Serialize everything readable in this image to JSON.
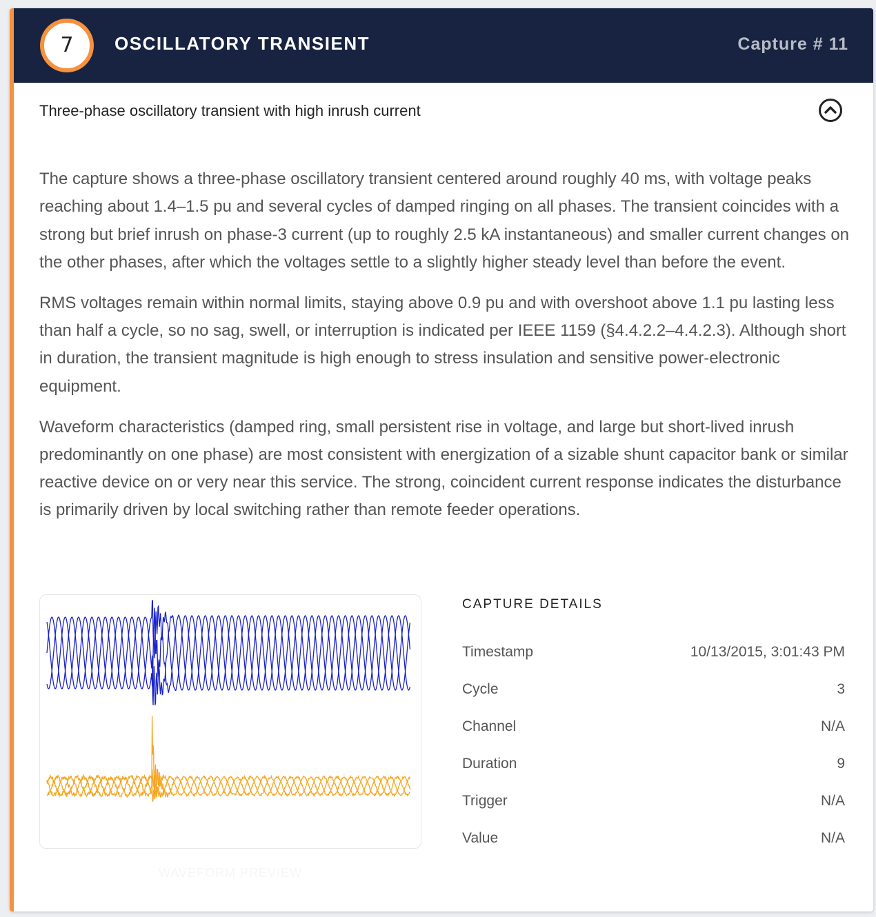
{
  "header": {
    "number": "7",
    "title": "OSCILLATORY TRANSIENT",
    "capture": "Capture # 11"
  },
  "subtitle": "Three-phase oscillatory transient with high inrush current",
  "icons": {
    "collapse": "chevron-up-circle-icon"
  },
  "description": [
    "The capture shows a three-phase oscillatory transient centered around roughly 40 ms, with voltage peaks reaching about 1.4–1.5 pu and several cycles of damped ringing on all phases. The transient coincides with a strong but brief inrush on phase-3 current (up to roughly 2.5 kA instantaneous) and smaller current changes on the other phases, after which the voltages settle to a slightly higher steady level than before the event.",
    "RMS voltages remain within normal limits, staying above 0.9 pu and with overshoot above 1.1 pu lasting less than half a cycle, so no sag, swell, or interruption is indicated per IEEE 1159 (§4.4.2.2–4.4.2.3). Although short in duration, the transient magnitude is high enough to stress insulation and sensitive power-electronic equipment.",
    "Waveform characteristics (damped ring, small persistent rise in voltage, and large but short-lived inrush predominantly on one phase) are most consistent with energization of a sizable shunt capacitor bank or similar reactive device on or very near this service. The strong, coincident current response indicates the disturbance is primarily driven by local switching rather than remote feeder operations."
  ],
  "preview": {
    "label": "WAVEFORM PREVIEW"
  },
  "details": {
    "heading": "CAPTURE DETAILS",
    "rows": [
      {
        "key": "Timestamp",
        "value": "10/13/2015, 3:01:43 PM"
      },
      {
        "key": "Cycle",
        "value": "3"
      },
      {
        "key": "Channel",
        "value": "N/A"
      },
      {
        "key": "Duration",
        "value": "9"
      },
      {
        "key": "Trigger",
        "value": "N/A"
      },
      {
        "key": "Value",
        "value": "N/A"
      }
    ]
  },
  "colors": {
    "accent": "#f7913d",
    "header_bg": "#172341",
    "voltage_trace": "#1a22c8",
    "current_trace": "#f5a623"
  }
}
